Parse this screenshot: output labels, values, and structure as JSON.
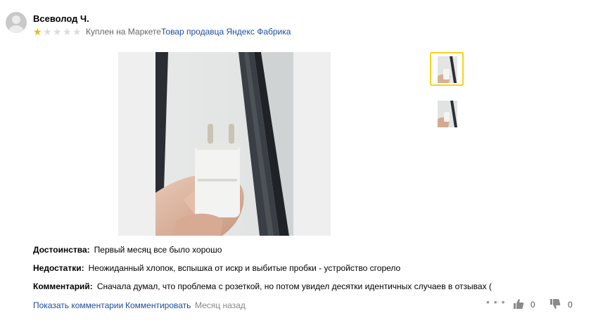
{
  "review": {
    "author": "Всеволод Ч.",
    "rating": 1,
    "rating_max": 5,
    "bought_text": "Куплен на Маркете",
    "seller_link": "Товар продавца Яндекс Фабрика",
    "pros_label": "Достоинства:",
    "pros": "Первый месяц все было хорошо",
    "cons_label": "Недостатки:",
    "cons": "Неожиданный хлопок, вспышка от искр и выбитые пробки - устройство сгорело",
    "comment_label": "Комментарий:",
    "comment": "Сначала думал, что проблема с розеткой, но потом увидел десятки идентичных случаев в отзывах (",
    "date": "Месяц назад"
  },
  "footer": {
    "show_comments": "Показать комментарии",
    "comment_action": "Комментировать",
    "more_glyph": "• • •",
    "likes": "0",
    "dislikes": "0"
  },
  "icons": {
    "avatar": "user-placeholder",
    "like": "thumbs-up-icon",
    "dislike": "thumbs-down-icon",
    "more": "ellipsis-icon"
  },
  "colors": {
    "star_filled": "#f2b705",
    "star_empty": "#dcdcdc",
    "link": "#1a4d9c",
    "thumb_active_border": "#f5d41c"
  }
}
